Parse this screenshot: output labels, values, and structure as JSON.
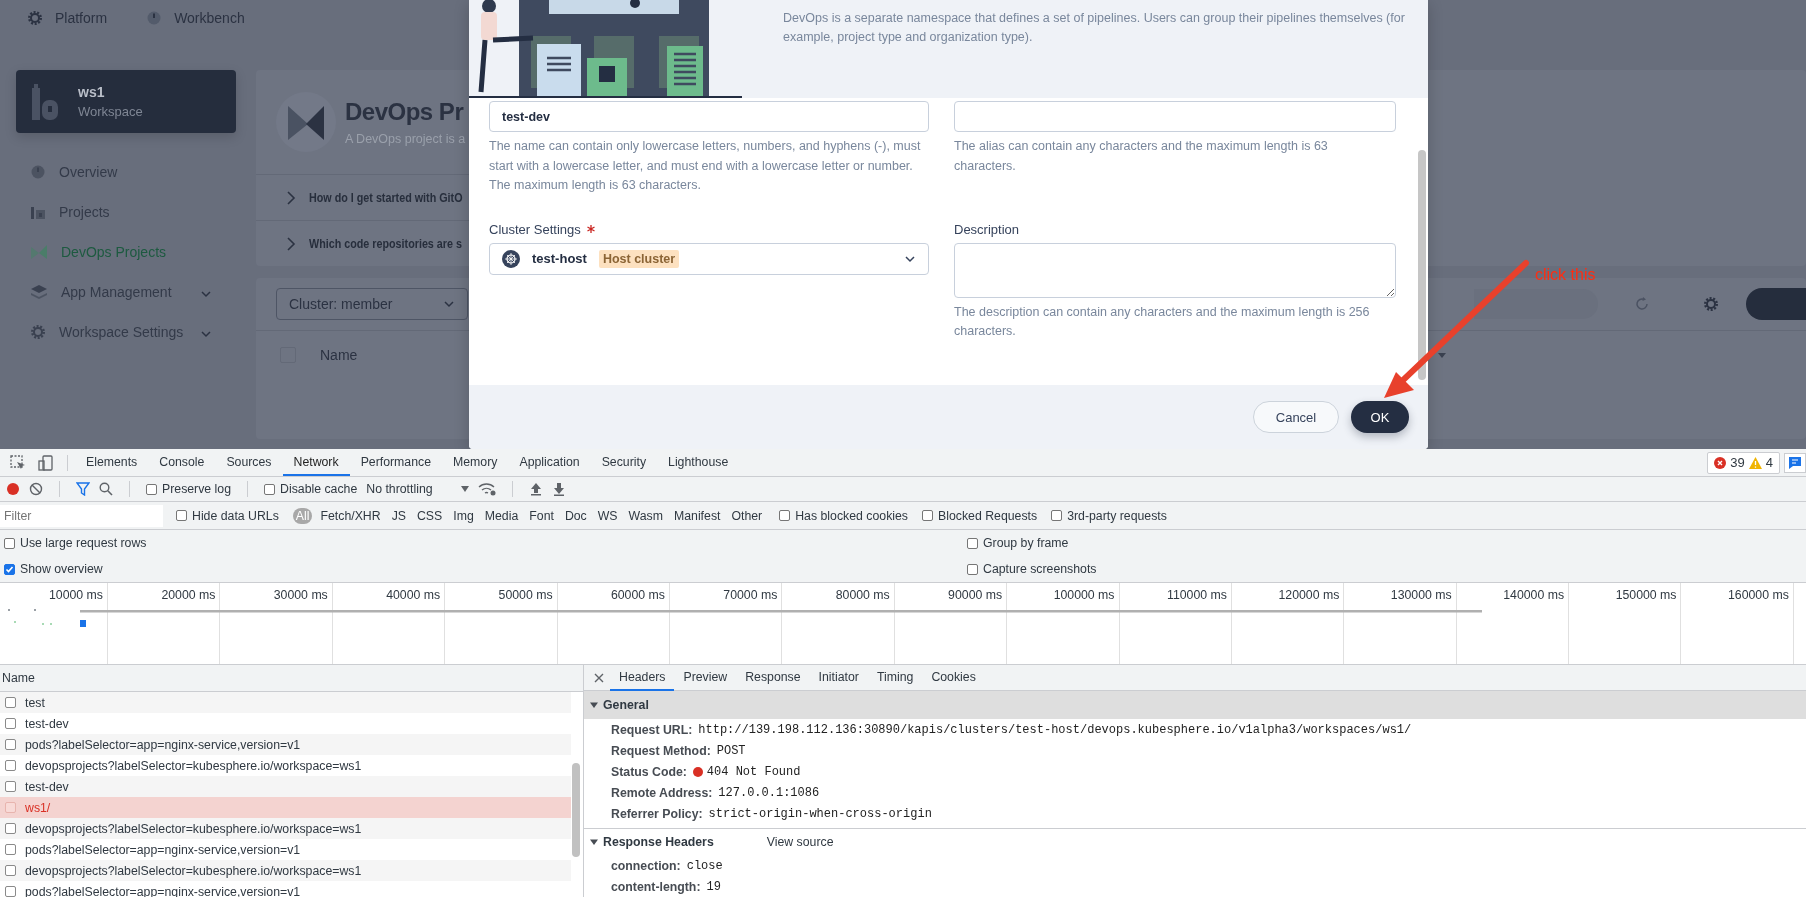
{
  "app": {
    "top_nav": [
      {
        "label": "Platform"
      },
      {
        "label": "Workbench"
      }
    ],
    "workspace": {
      "name": "ws1",
      "type": "Workspace"
    },
    "sidebar": {
      "items": [
        {
          "label": "Overview",
          "selected": false,
          "expandable": false
        },
        {
          "label": "Projects",
          "selected": false,
          "expandable": false
        },
        {
          "label": "DevOps Projects",
          "selected": true,
          "expandable": false
        },
        {
          "label": "App Management",
          "selected": false,
          "expandable": true
        },
        {
          "label": "Workspace Settings",
          "selected": false,
          "expandable": true
        }
      ]
    },
    "page_header": {
      "title": "DevOps Pr",
      "subtitle": "A DevOps project is a"
    },
    "faq": [
      {
        "question": "How do I get started with GitO"
      },
      {
        "question": "Which code repositories are s"
      }
    ],
    "toolbar": {
      "cluster_filter": "Cluster: member"
    },
    "table": {
      "select_all": {
        "checked": false
      },
      "columns": [
        "Name"
      ]
    },
    "annotation": {
      "text": "click this"
    }
  },
  "modal": {
    "description": "DevOps is a separate namespace that defines a set of pipelines. Users can group their pipelines themselves (for example, project type and organization type).",
    "name_field": {
      "value": "test-dev",
      "hint": "The name can contain only lowercase letters, numbers, and hyphens (-), must start with a lowercase letter, and must end with a lowercase letter or number. The maximum length is 63 characters."
    },
    "alias_field": {
      "hint": "The alias can contain any characters and the maximum length is 63 characters."
    },
    "cluster_field": {
      "label": "Cluster Settings",
      "required": true,
      "value": "test-host",
      "tag": "Host cluster"
    },
    "description_field": {
      "label": "Description",
      "hint": "The description can contain any characters and the maximum length is 256 characters."
    },
    "buttons": [
      {
        "label": "Cancel",
        "kind": "secondary"
      },
      {
        "label": "OK",
        "kind": "primary"
      }
    ]
  },
  "devtools": {
    "tabs": [
      {
        "label": "Elements",
        "selected": false
      },
      {
        "label": "Console",
        "selected": false
      },
      {
        "label": "Sources",
        "selected": false
      },
      {
        "label": "Network",
        "selected": true
      },
      {
        "label": "Performance",
        "selected": false
      },
      {
        "label": "Memory",
        "selected": false
      },
      {
        "label": "Application",
        "selected": false
      },
      {
        "label": "Security",
        "selected": false
      },
      {
        "label": "Lighthouse",
        "selected": false
      }
    ],
    "issues": {
      "errors": "39",
      "warnings": "4"
    },
    "toolbar": {
      "recording": true,
      "preserve_log": {
        "label": "Preserve log",
        "checked": false
      },
      "disable_cache": {
        "label": "Disable cache",
        "checked": false
      },
      "throttling": "No throttling"
    },
    "filter_bar": {
      "placeholder": "Filter",
      "hide_data_urls": {
        "label": "Hide data URLs",
        "checked": false
      },
      "types": [
        {
          "label": "All",
          "selected": true
        },
        {
          "label": "Fetch/XHR",
          "selected": false
        },
        {
          "label": "JS",
          "selected": false
        },
        {
          "label": "CSS",
          "selected": false
        },
        {
          "label": "Img",
          "selected": false
        },
        {
          "label": "Media",
          "selected": false
        },
        {
          "label": "Font",
          "selected": false
        },
        {
          "label": "Doc",
          "selected": false
        },
        {
          "label": "WS",
          "selected": false
        },
        {
          "label": "Wasm",
          "selected": false
        },
        {
          "label": "Manifest",
          "selected": false
        },
        {
          "label": "Other",
          "selected": false
        }
      ],
      "extra": [
        {
          "label": "Has blocked cookies",
          "checked": false
        },
        {
          "label": "Blocked Requests",
          "checked": false
        },
        {
          "label": "3rd-party requests",
          "checked": false
        }
      ]
    },
    "settings": {
      "left": [
        {
          "label": "Use large request rows",
          "checked": false
        },
        {
          "label": "Show overview",
          "checked": true
        }
      ],
      "right": [
        {
          "label": "Group by frame",
          "checked": false
        },
        {
          "label": "Capture screenshots",
          "checked": false
        }
      ]
    },
    "overview": {
      "ticks": [
        "10000 ms",
        "20000 ms",
        "30000 ms",
        "40000 ms",
        "50000 ms",
        "60000 ms",
        "70000 ms",
        "80000 ms",
        "90000 ms",
        "100000 ms",
        "110000 ms",
        "120000 ms",
        "130000 ms",
        "140000 ms",
        "150000 ms",
        "160000 ms"
      ]
    },
    "requests": {
      "column": "Name",
      "rows": [
        {
          "name": "test",
          "failed": false
        },
        {
          "name": "test-dev",
          "failed": false
        },
        {
          "name": "pods?labelSelector=app=nginx-service,version=v1",
          "failed": false
        },
        {
          "name": "devopsprojects?labelSelector=kubesphere.io/workspace=ws1",
          "failed": false
        },
        {
          "name": "test-dev",
          "failed": false
        },
        {
          "name": "ws1/",
          "failed": true
        },
        {
          "name": "devopsprojects?labelSelector=kubesphere.io/workspace=ws1",
          "failed": false
        },
        {
          "name": "pods?labelSelector=app=nginx-service,version=v1",
          "failed": false
        },
        {
          "name": "devopsprojects?labelSelector=kubesphere.io/workspace=ws1",
          "failed": false
        },
        {
          "name": "pods?labelSelector=app=nginx-service,version=v1",
          "failed": false
        }
      ]
    },
    "details": {
      "tabs": [
        {
          "label": "Headers",
          "selected": true
        },
        {
          "label": "Preview",
          "selected": false
        },
        {
          "label": "Response",
          "selected": false
        },
        {
          "label": "Initiator",
          "selected": false
        },
        {
          "label": "Timing",
          "selected": false
        },
        {
          "label": "Cookies",
          "selected": false
        }
      ],
      "general": {
        "title": "General",
        "expanded": true,
        "rows": [
          {
            "key": "Request URL:",
            "value": "http://139.198.112.136:30890/kapis/clusters/test-host/devops.kubesphere.io/v1alpha3/workspaces/ws1/",
            "kind": "text"
          },
          {
            "key": "Request Method:",
            "value": "POST",
            "kind": "text"
          },
          {
            "key": "Status Code:",
            "value": "404 Not Found",
            "kind": "status"
          },
          {
            "key": "Remote Address:",
            "value": "127.0.0.1:1086",
            "kind": "text"
          },
          {
            "key": "Referrer Policy:",
            "value": "strict-origin-when-cross-origin",
            "kind": "text"
          }
        ]
      },
      "response_headers": {
        "title": "Response Headers",
        "expanded": true,
        "link": "View source",
        "rows": [
          {
            "key": "connection:",
            "value": "close",
            "kind": "text"
          },
          {
            "key": "content-length:",
            "value": "19",
            "kind": "text"
          }
        ]
      }
    }
  }
}
